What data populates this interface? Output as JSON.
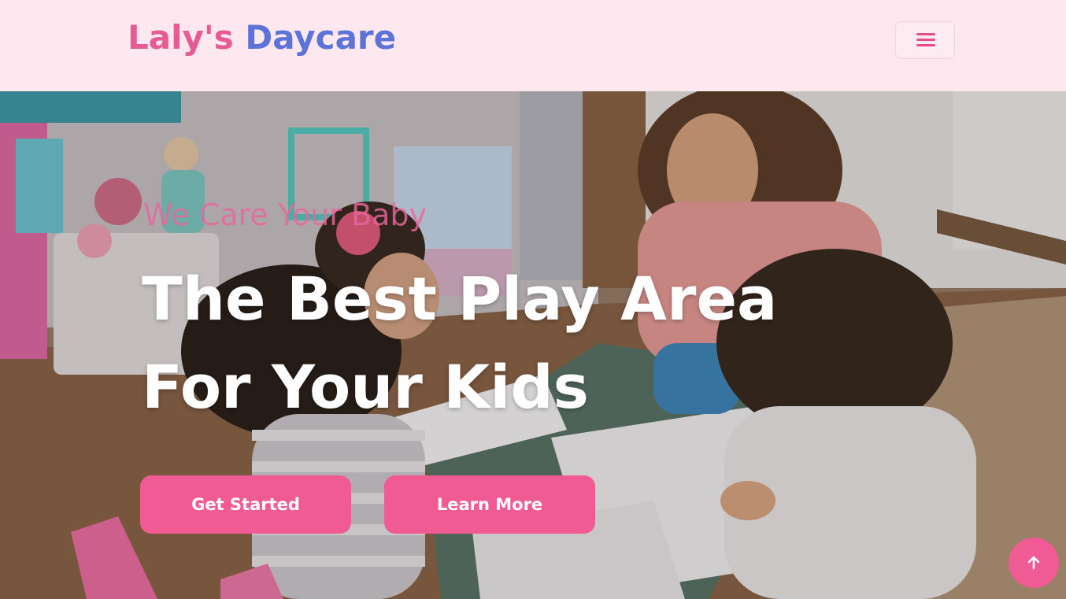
{
  "navbar": {
    "brand_part1": "Laly's",
    "brand_part2": "Daycare",
    "menu_icon": "hamburger-menu-icon"
  },
  "hero": {
    "eyebrow": "We Care Your Baby",
    "headline_line1": "The Best Play Area",
    "headline_line2": "For Your Kids",
    "primary_button": "Get Started",
    "secondary_button": "Learn More",
    "background_image": "teacher with children playing and drawing in a daycare room"
  },
  "back_to_top": {
    "icon": "arrow-up-icon"
  },
  "colors": {
    "accent_pink": "#f05b93",
    "brand_blue": "#5d73d8",
    "navbar_bg": "#fde8f0"
  }
}
